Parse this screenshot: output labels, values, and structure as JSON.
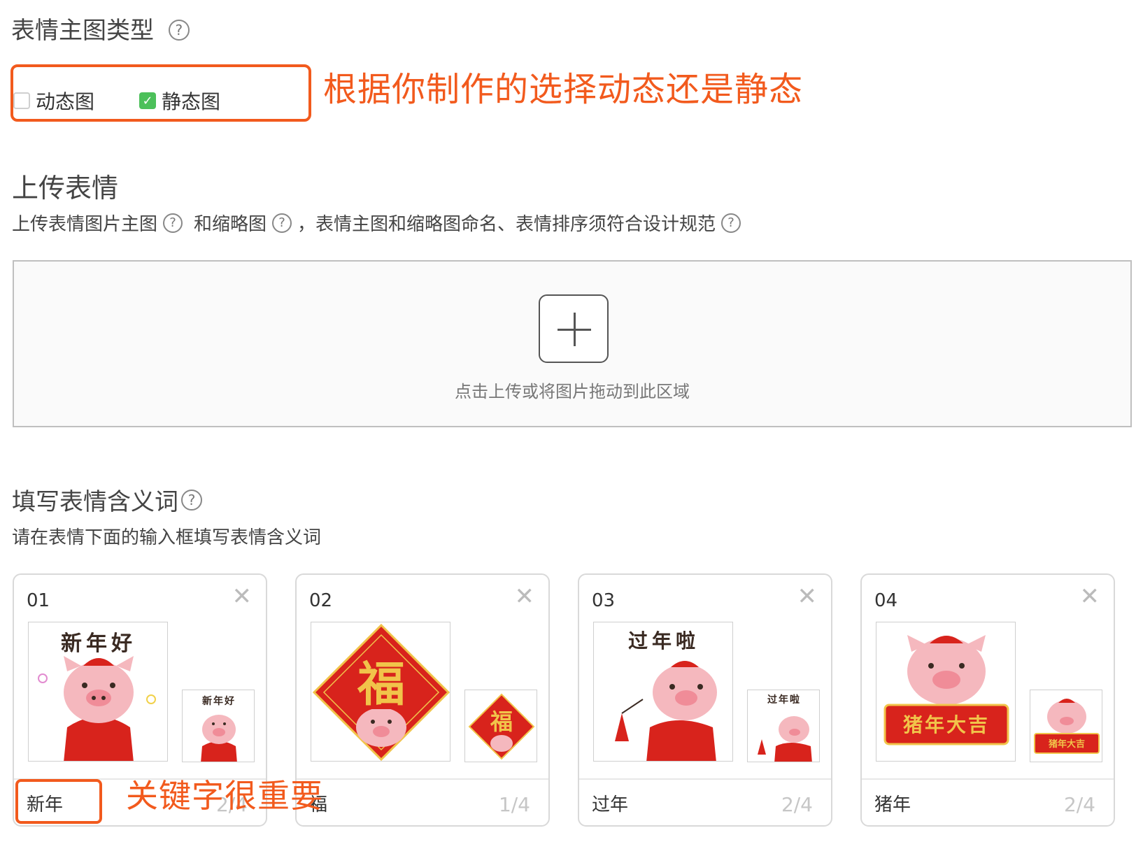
{
  "section_type": {
    "title": "表情主图类型",
    "help": "?",
    "options": [
      {
        "label": "动态图",
        "checked": false
      },
      {
        "label": "静态图",
        "checked": true
      }
    ],
    "annotation": "根据你制作的选择动态还是静态"
  },
  "section_upload": {
    "title": "上传表情",
    "sub_part1": "上传表情图片主图",
    "sub_part2": "和缩略图",
    "sub_part3": "，表情主图和缩略图命名、表情排序须符合设计规范",
    "help": "?",
    "hint": "点击上传或将图片拖动到此区域"
  },
  "section_meaning": {
    "title": "填写表情含义词",
    "help": "?",
    "subtitle": "请在表情下面的输入框填写表情含义词",
    "keyword_annotation": "关键字很重要"
  },
  "cards": [
    {
      "num": "01",
      "close": "✕",
      "word": "新年",
      "count": "2/4",
      "sticker_text": "新年好"
    },
    {
      "num": "02",
      "close": "✕",
      "word": "福",
      "count": "1/4",
      "sticker_text": "福"
    },
    {
      "num": "03",
      "close": "✕",
      "word": "过年",
      "count": "2/4",
      "sticker_text": "过年啦"
    },
    {
      "num": "04",
      "close": "✕",
      "word": "猪年",
      "count": "2/4",
      "sticker_text": "猪年大吉"
    }
  ],
  "colors": {
    "annotation": "#f25a1d",
    "checkbox_on": "#4cc05a",
    "pig_pink": "#f5b8be",
    "red_coat": "#d8231c"
  }
}
